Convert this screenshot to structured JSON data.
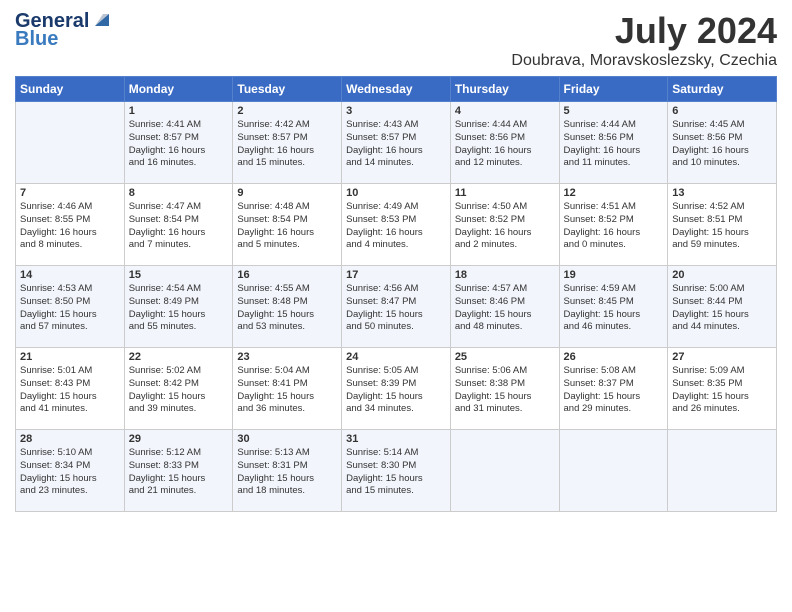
{
  "header": {
    "logo_line1": "General",
    "logo_line2": "Blue",
    "month": "July 2024",
    "location": "Doubrava, Moravskoslezsky, Czechia"
  },
  "days_of_week": [
    "Sunday",
    "Monday",
    "Tuesday",
    "Wednesday",
    "Thursday",
    "Friday",
    "Saturday"
  ],
  "weeks": [
    [
      {
        "day": "",
        "info": ""
      },
      {
        "day": "1",
        "info": "Sunrise: 4:41 AM\nSunset: 8:57 PM\nDaylight: 16 hours\nand 16 minutes."
      },
      {
        "day": "2",
        "info": "Sunrise: 4:42 AM\nSunset: 8:57 PM\nDaylight: 16 hours\nand 15 minutes."
      },
      {
        "day": "3",
        "info": "Sunrise: 4:43 AM\nSunset: 8:57 PM\nDaylight: 16 hours\nand 14 minutes."
      },
      {
        "day": "4",
        "info": "Sunrise: 4:44 AM\nSunset: 8:56 PM\nDaylight: 16 hours\nand 12 minutes."
      },
      {
        "day": "5",
        "info": "Sunrise: 4:44 AM\nSunset: 8:56 PM\nDaylight: 16 hours\nand 11 minutes."
      },
      {
        "day": "6",
        "info": "Sunrise: 4:45 AM\nSunset: 8:56 PM\nDaylight: 16 hours\nand 10 minutes."
      }
    ],
    [
      {
        "day": "7",
        "info": "Sunrise: 4:46 AM\nSunset: 8:55 PM\nDaylight: 16 hours\nand 8 minutes."
      },
      {
        "day": "8",
        "info": "Sunrise: 4:47 AM\nSunset: 8:54 PM\nDaylight: 16 hours\nand 7 minutes."
      },
      {
        "day": "9",
        "info": "Sunrise: 4:48 AM\nSunset: 8:54 PM\nDaylight: 16 hours\nand 5 minutes."
      },
      {
        "day": "10",
        "info": "Sunrise: 4:49 AM\nSunset: 8:53 PM\nDaylight: 16 hours\nand 4 minutes."
      },
      {
        "day": "11",
        "info": "Sunrise: 4:50 AM\nSunset: 8:52 PM\nDaylight: 16 hours\nand 2 minutes."
      },
      {
        "day": "12",
        "info": "Sunrise: 4:51 AM\nSunset: 8:52 PM\nDaylight: 16 hours\nand 0 minutes."
      },
      {
        "day": "13",
        "info": "Sunrise: 4:52 AM\nSunset: 8:51 PM\nDaylight: 15 hours\nand 59 minutes."
      }
    ],
    [
      {
        "day": "14",
        "info": "Sunrise: 4:53 AM\nSunset: 8:50 PM\nDaylight: 15 hours\nand 57 minutes."
      },
      {
        "day": "15",
        "info": "Sunrise: 4:54 AM\nSunset: 8:49 PM\nDaylight: 15 hours\nand 55 minutes."
      },
      {
        "day": "16",
        "info": "Sunrise: 4:55 AM\nSunset: 8:48 PM\nDaylight: 15 hours\nand 53 minutes."
      },
      {
        "day": "17",
        "info": "Sunrise: 4:56 AM\nSunset: 8:47 PM\nDaylight: 15 hours\nand 50 minutes."
      },
      {
        "day": "18",
        "info": "Sunrise: 4:57 AM\nSunset: 8:46 PM\nDaylight: 15 hours\nand 48 minutes."
      },
      {
        "day": "19",
        "info": "Sunrise: 4:59 AM\nSunset: 8:45 PM\nDaylight: 15 hours\nand 46 minutes."
      },
      {
        "day": "20",
        "info": "Sunrise: 5:00 AM\nSunset: 8:44 PM\nDaylight: 15 hours\nand 44 minutes."
      }
    ],
    [
      {
        "day": "21",
        "info": "Sunrise: 5:01 AM\nSunset: 8:43 PM\nDaylight: 15 hours\nand 41 minutes."
      },
      {
        "day": "22",
        "info": "Sunrise: 5:02 AM\nSunset: 8:42 PM\nDaylight: 15 hours\nand 39 minutes."
      },
      {
        "day": "23",
        "info": "Sunrise: 5:04 AM\nSunset: 8:41 PM\nDaylight: 15 hours\nand 36 minutes."
      },
      {
        "day": "24",
        "info": "Sunrise: 5:05 AM\nSunset: 8:39 PM\nDaylight: 15 hours\nand 34 minutes."
      },
      {
        "day": "25",
        "info": "Sunrise: 5:06 AM\nSunset: 8:38 PM\nDaylight: 15 hours\nand 31 minutes."
      },
      {
        "day": "26",
        "info": "Sunrise: 5:08 AM\nSunset: 8:37 PM\nDaylight: 15 hours\nand 29 minutes."
      },
      {
        "day": "27",
        "info": "Sunrise: 5:09 AM\nSunset: 8:35 PM\nDaylight: 15 hours\nand 26 minutes."
      }
    ],
    [
      {
        "day": "28",
        "info": "Sunrise: 5:10 AM\nSunset: 8:34 PM\nDaylight: 15 hours\nand 23 minutes."
      },
      {
        "day": "29",
        "info": "Sunrise: 5:12 AM\nSunset: 8:33 PM\nDaylight: 15 hours\nand 21 minutes."
      },
      {
        "day": "30",
        "info": "Sunrise: 5:13 AM\nSunset: 8:31 PM\nDaylight: 15 hours\nand 18 minutes."
      },
      {
        "day": "31",
        "info": "Sunrise: 5:14 AM\nSunset: 8:30 PM\nDaylight: 15 hours\nand 15 minutes."
      },
      {
        "day": "",
        "info": ""
      },
      {
        "day": "",
        "info": ""
      },
      {
        "day": "",
        "info": ""
      }
    ]
  ]
}
